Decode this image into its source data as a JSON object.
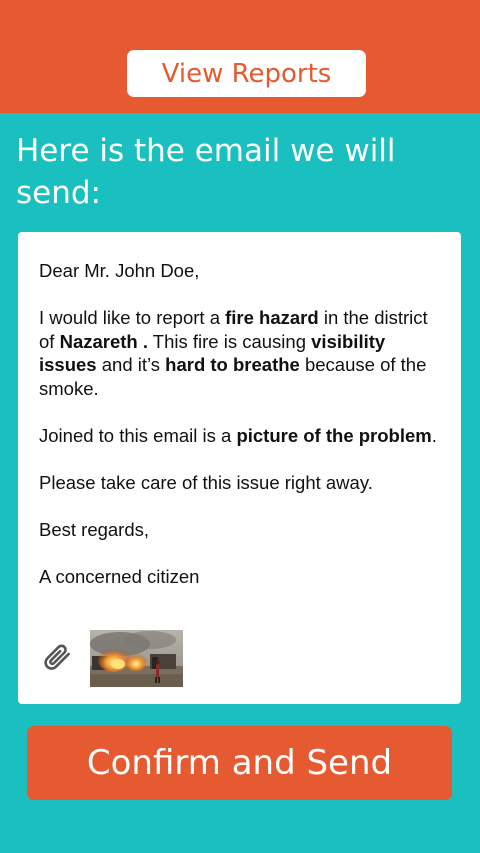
{
  "header": {
    "view_reports_label": "View Reports"
  },
  "intro": {
    "heading": "Here is the email we will send:"
  },
  "email": {
    "greeting": "Dear Mr. John Doe,",
    "p1_a": "I would like to report a ",
    "p1_b": "fire hazard",
    "p1_c": " in the district of ",
    "p1_d": "Nazareth .",
    "p1_e": " This fire is causing ",
    "p1_f": "visibility issues",
    "p1_g": " and it’s ",
    "p1_h": "hard to breathe",
    "p1_i": " because of the smoke.",
    "p2_a": "Joined to this email is a ",
    "p2_b": "picture of the problem",
    "p2_c": ".",
    "p3": "Please take care of this issue right away.",
    "closing": "Best regards,",
    "signature": "A concerned citizen"
  },
  "attachment": {
    "icon": "paperclip-icon",
    "thumbnail": "fire-photo-thumbnail"
  },
  "actions": {
    "confirm_label": "Confirm and Send"
  },
  "colors": {
    "primary": "#E55A31",
    "background": "#1ABFBF",
    "card": "#FFFFFF"
  }
}
